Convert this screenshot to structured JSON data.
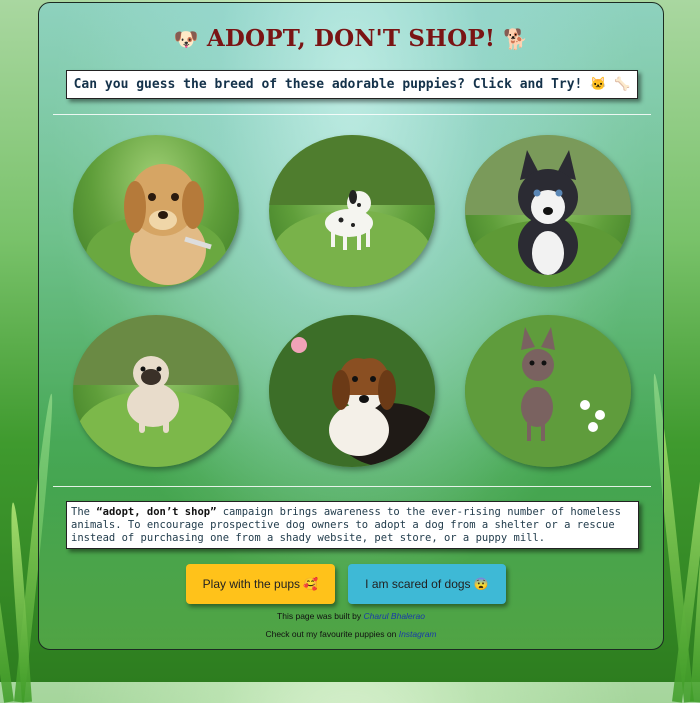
{
  "header": {
    "title": "ADOPT, DON'T SHOP!",
    "emoji_left": "🐶",
    "emoji_right": "🐕"
  },
  "prompt": {
    "text": "Can you guess the breed of these adorable puppies? Click and Try! 🐱 🦴"
  },
  "gallery": {
    "puppies": [
      {
        "icon": "golden-retriever-puppy",
        "fur": "#d4a563"
      },
      {
        "icon": "dalmatian-puppy",
        "fur": "#f5f5f0"
      },
      {
        "icon": "husky-puppy",
        "fur": "#2b2b33"
      },
      {
        "icon": "pug-puppy",
        "fur": "#e8dccb"
      },
      {
        "icon": "beagle-puppy",
        "fur": "#8a4f22"
      },
      {
        "icon": "chihuahua-puppy",
        "fur": "#7a6260"
      }
    ]
  },
  "description": {
    "intro": "The ",
    "highlight": "“adopt, don’t shop”",
    "body": " campaign brings awareness to the ever-rising number of homeless animals. To encourage prospective dog owners to adopt a dog from a shelter or a rescue instead of purchasing one from a shady website, pet store, or a puppy mill."
  },
  "buttons": {
    "play_label": "Play with the pups 🥰",
    "scared_label": "I am scared of dogs 😨"
  },
  "footer": {
    "built_by_prefix": "This page was built by ",
    "author_link": "Charul Bhalerao",
    "favourites_prefix": "Check out my favourite puppies on ",
    "instagram_link": "Instagram"
  },
  "colors": {
    "title": "#7a1414",
    "play_button": "#ffc21a",
    "scared_button": "#3eb9d6",
    "link": "#1a3aa8"
  }
}
